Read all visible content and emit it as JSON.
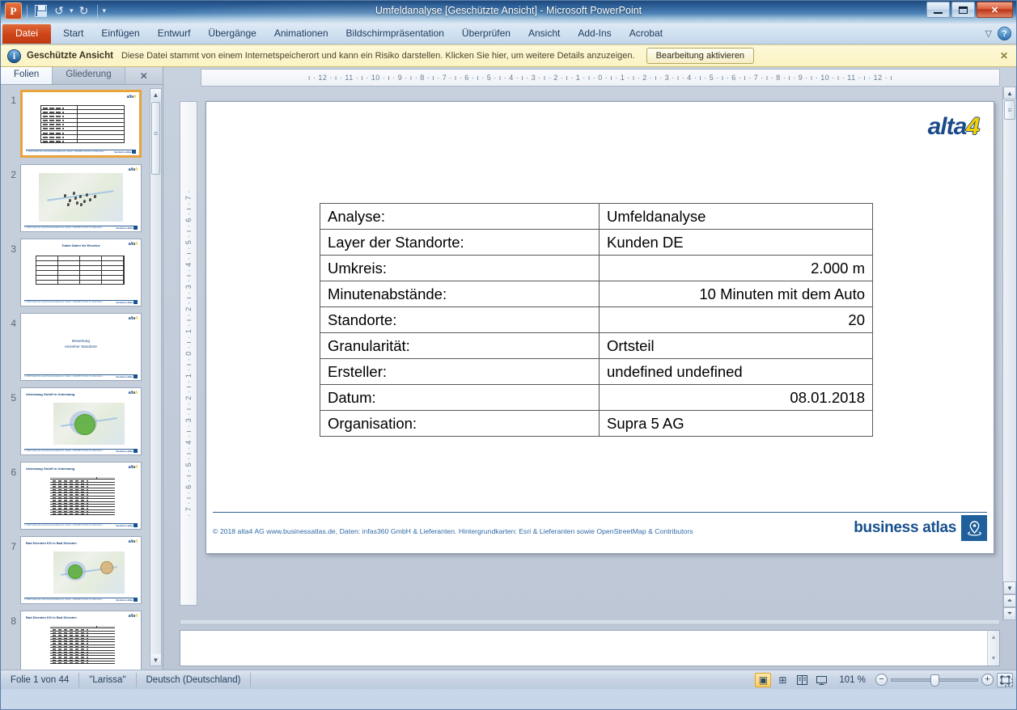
{
  "window": {
    "title": "Umfeldanalyse [Geschützte Ansicht]  -  Microsoft PowerPoint",
    "app_badge": "P",
    "minimize": "minimize-icon",
    "maximize": "restore-icon",
    "close": "✕"
  },
  "quick_access": {
    "save": "save-icon",
    "undo": "↺",
    "undo_arrow": "▾",
    "redo": "↻",
    "customize": "▾"
  },
  "ribbon": {
    "tabs": [
      {
        "label": "Datei",
        "active": true
      },
      {
        "label": "Start",
        "active": false
      },
      {
        "label": "Einfügen",
        "active": false
      },
      {
        "label": "Entwurf",
        "active": false
      },
      {
        "label": "Übergänge",
        "active": false
      },
      {
        "label": "Animationen",
        "active": false
      },
      {
        "label": "Bildschirmpräsentation",
        "active": false
      },
      {
        "label": "Überprüfen",
        "active": false
      },
      {
        "label": "Ansicht",
        "active": false
      },
      {
        "label": "Add-Ins",
        "active": false
      },
      {
        "label": "Acrobat",
        "active": false
      }
    ],
    "collapse_icon": "▽",
    "help_label": "?"
  },
  "protected_view": {
    "icon": "i",
    "title": "Geschützte Ansicht",
    "message": "Diese Datei stammt von einem Internetspeicherort und kann ein Risiko darstellen. Klicken Sie hier, um weitere Details anzuzeigen.",
    "button": "Bearbeitung aktivieren",
    "close": "✕"
  },
  "slide_pane": {
    "tabs": [
      {
        "label": "Folien",
        "active": true
      },
      {
        "label": "Gliederung",
        "active": false
      }
    ],
    "close": "✕",
    "thumbnails": [
      {
        "number": "1",
        "kind": "table",
        "selected": true,
        "title": ""
      },
      {
        "number": "2",
        "kind": "map-points",
        "selected": false,
        "title": ""
      },
      {
        "number": "3",
        "kind": "small-table",
        "selected": false,
        "title": "Totale Daten für Einzelne"
      },
      {
        "number": "4",
        "kind": "text",
        "selected": false,
        "title": "",
        "text1": "Bewertung",
        "text2": "einzelner   Standorte"
      },
      {
        "number": "5",
        "kind": "map-circle",
        "selected": false,
        "title": "Unterwang GmbH in Unterwang"
      },
      {
        "number": "6",
        "kind": "grid",
        "selected": false,
        "title": "Unterwang GmbH in Unterwang"
      },
      {
        "number": "7",
        "kind": "map-two-circles",
        "selected": false,
        "title": "Bad Dieroten KG in Bad Dieroten"
      },
      {
        "number": "8",
        "kind": "grid",
        "selected": false,
        "title": "Bad Dieroten KG in Bad Dieroten"
      }
    ],
    "scroll_up": "▲",
    "scroll_down": "▼"
  },
  "rulers": {
    "horizontal": "ı · 12 · ı · 11 · ı · 10 · ı · 9 · ı · 8 · ı · 7 · ı · 6 · ı · 5 · ı · 4 · ı · 3 · ı · 2 · ı · 1 · ı · 0 · ı · 1 · ı · 2 · ı · 3 · ı · 4 · ı · 5 · ı · 6 · ı · 7 · ı · 8 · ı · 9 · ı · 10 · ı · 11 · ı · 12 · ı",
    "vertical": "· 7 · ı · 6 · ı · 5 · ı · 4 · ı · 3 · ı · 2 · ı · 1 · ı · 0 · ı · 1 · ı · 2 · ı · 3 · ı · 4 · ı · 5 · ı · 6 · ı · 7 ·"
  },
  "slide": {
    "logo": {
      "text": "alta",
      "accent": "4",
      "color": "#1b4a8a",
      "accent_color": "#f5d000"
    },
    "table": [
      {
        "key": "Analyse:",
        "value": "Umfeldanalyse",
        "align": "left"
      },
      {
        "key": "Layer der Standorte:",
        "value": "Kunden DE",
        "align": "left"
      },
      {
        "key": "Umkreis:",
        "value": "2.000 m",
        "align": "right"
      },
      {
        "key": "Minutenabstände:",
        "value": "10 Minuten mit dem Auto",
        "align": "right"
      },
      {
        "key": "Standorte:",
        "value": "20",
        "align": "right"
      },
      {
        "key": "Granularität:",
        "value": "Ortsteil",
        "align": "left"
      },
      {
        "key": "Ersteller:",
        "value": "undefined undefined",
        "align": "left"
      },
      {
        "key": "Datum:",
        "value": "08.01.2018",
        "align": "right"
      },
      {
        "key": "Organisation:",
        "value": "Supra 5 AG",
        "align": "left"
      }
    ],
    "footer_text": "© 2018 alta4 AG www.businessatlas.de, Daten: infas360 GmbH  & Lieferanten. Hintergrundkarten: Esri & Lieferanten sowie OpenStreetMap & Contributors",
    "brand": {
      "text": "business atlas",
      "mark": "map-pin-icon",
      "color": "#17508e"
    }
  },
  "scrollbars": {
    "up": "▲",
    "down": "▼",
    "prev_slide": "⏶",
    "next_slide": "⏷",
    "thumb": "≡"
  },
  "status_bar": {
    "slide_counter": "Folie 1 von 44",
    "theme": "\"Larissa\"",
    "language": "Deutsch (Deutschland)",
    "views": [
      {
        "name": "normal-view",
        "glyph": "▣",
        "active": true
      },
      {
        "name": "slide-sorter-view",
        "glyph": "⊞",
        "active": false
      },
      {
        "name": "reading-view",
        "glyph": "📖",
        "active": false
      },
      {
        "name": "slide-show-view",
        "glyph": "▭",
        "active": false
      }
    ],
    "zoom_level": "101 %",
    "zoom_out": "−",
    "zoom_in": "+",
    "fit_to_window": "⛶"
  }
}
